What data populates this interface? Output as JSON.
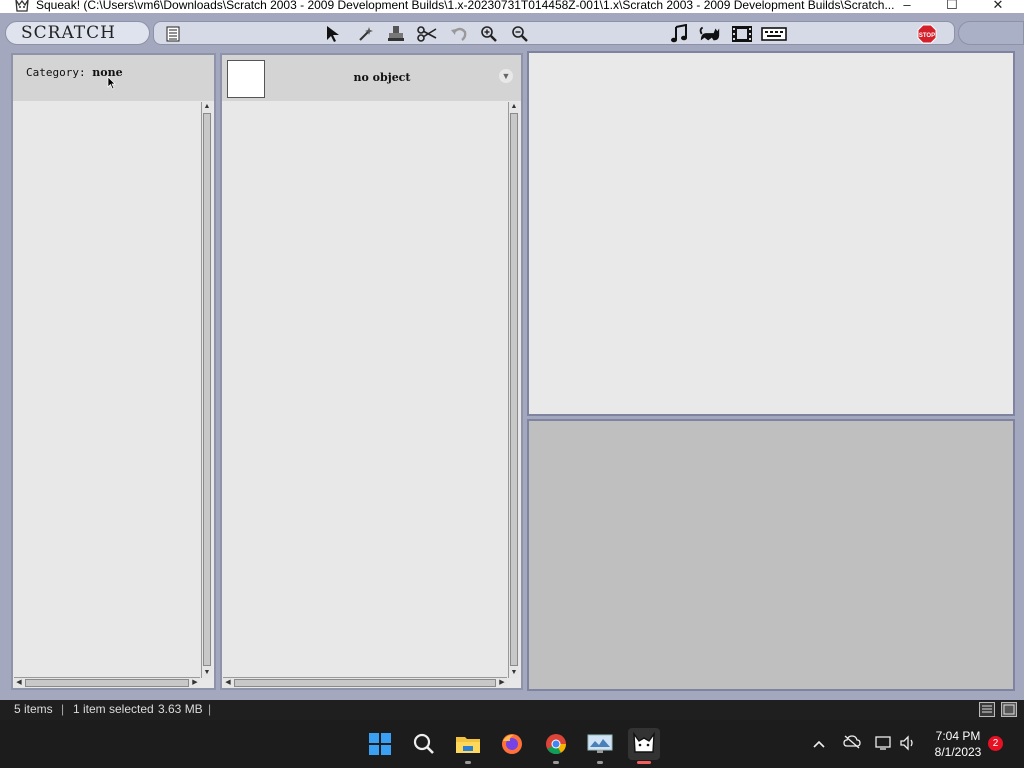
{
  "window": {
    "title": "Squeak! (C:\\Users\\vm6\\Downloads\\Scratch 2003 - 2009 Development Builds\\1.x-20230731T014458Z-001\\1.x\\Scratch 2003 - 2009 Development Builds\\Scratch...",
    "minimize": "–",
    "maximize": "☐",
    "close": "✕"
  },
  "toolbar": {
    "logo": "SCRATCH",
    "tools": [
      "page-icon",
      "arrow-cursor-icon",
      "magic-wand-icon",
      "stamp-icon",
      "scissors-icon",
      "undo-icon",
      "zoom-in-icon",
      "zoom-out-icon",
      "music-note-icon",
      "cat-icon",
      "film-icon",
      "keyboard-icon"
    ],
    "stop_label": "STOP"
  },
  "palette": {
    "category_label": "Category:",
    "category_value": "none"
  },
  "object_panel": {
    "name": "no object",
    "menu_glyph": "▼"
  },
  "statusbar": {
    "items": "5 items",
    "selected": "1 item selected",
    "size": "3.63 MB"
  },
  "taskbar": {
    "time": "7:04 PM",
    "date": "8/1/2023",
    "notification_count": "2"
  },
  "colors": {
    "app_background": "#a3a8bf",
    "panel_background": "#e8e8e8",
    "stop_red": "#d4202a",
    "taskbar": "#1c1c1c"
  }
}
